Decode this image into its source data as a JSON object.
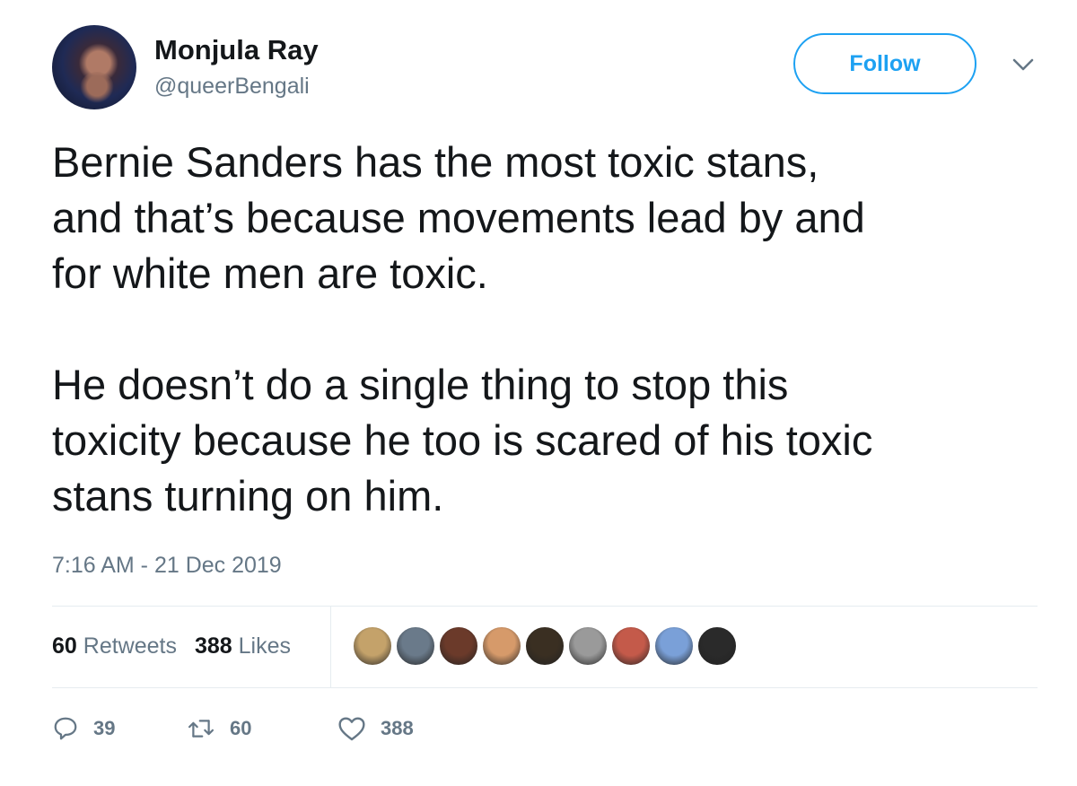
{
  "author": {
    "name": "Monjula Ray",
    "handle": "@queerBengali"
  },
  "follow_label": "Follow",
  "tweet": {
    "text": "Bernie Sanders has the most toxic stans,\nand that’s because movements lead by and\nfor white men are toxic.\n\nHe doesn’t do a single thing to stop this\ntoxicity because he too is scared of his toxic\nstans turning on him.",
    "timestamp": "7:16 AM - 21 Dec 2019"
  },
  "stats": {
    "retweets_count": "60",
    "retweets_label": "Retweets",
    "likes_count": "388",
    "likes_label": "Likes"
  },
  "likers": [
    {
      "color": "#c4a26a"
    },
    {
      "color": "#6a7a8a"
    },
    {
      "color": "#6b3a2a"
    },
    {
      "color": "#d69a6a"
    },
    {
      "color": "#3a2f22"
    },
    {
      "color": "#9a9a9a"
    },
    {
      "color": "#c45a4a"
    },
    {
      "color": "#7aa0d8"
    },
    {
      "color": "#2a2a2a"
    }
  ],
  "actions": {
    "replies": "39",
    "retweets": "60",
    "likes": "388"
  },
  "colors": {
    "accent": "#1da1f2",
    "muted": "#657786",
    "text": "#14171a",
    "border": "#e6ecf0"
  }
}
